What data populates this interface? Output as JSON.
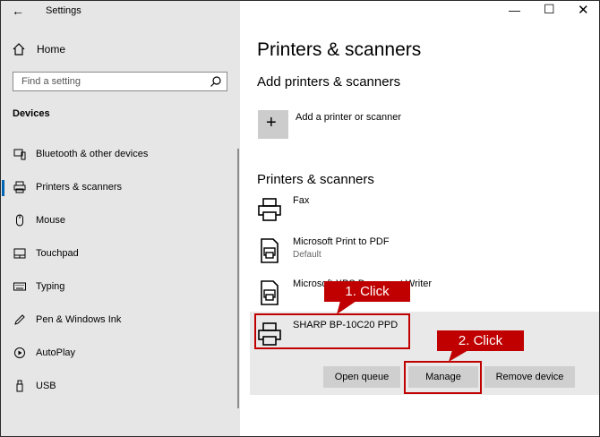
{
  "app": {
    "title": "Settings"
  },
  "sidebar": {
    "home_label": "Home",
    "search_placeholder": "Find a setting",
    "section_title": "Devices",
    "items": [
      {
        "label": "Bluetooth & other devices",
        "icon": "bluetooth-devices-icon"
      },
      {
        "label": "Printers & scanners",
        "icon": "printer-icon",
        "active": true
      },
      {
        "label": "Mouse",
        "icon": "mouse-icon"
      },
      {
        "label": "Touchpad",
        "icon": "touchpad-icon"
      },
      {
        "label": "Typing",
        "icon": "keyboard-icon"
      },
      {
        "label": "Pen & Windows Ink",
        "icon": "pen-icon"
      },
      {
        "label": "AutoPlay",
        "icon": "autoplay-icon"
      },
      {
        "label": "USB",
        "icon": "usb-icon"
      }
    ]
  },
  "main": {
    "title": "Printers & scanners",
    "add_section_title": "Add printers & scanners",
    "add_label": "Add a printer or scanner",
    "list_section_title": "Printers & scanners",
    "printers": [
      {
        "name": "Fax",
        "sub": ""
      },
      {
        "name": "Microsoft Print to PDF",
        "sub": "Default"
      },
      {
        "name": "Microsoft XPS Document Writer",
        "sub": ""
      },
      {
        "name": "SHARP BP-10C20 PPD",
        "sub": "",
        "selected": true
      }
    ],
    "buttons": {
      "open_queue": "Open queue",
      "manage": "Manage",
      "remove": "Remove device"
    }
  },
  "callouts": {
    "step1": "1. Click",
    "step2": "2. Click"
  },
  "colors": {
    "accent": "#0063b1",
    "callout": "#c00000"
  }
}
